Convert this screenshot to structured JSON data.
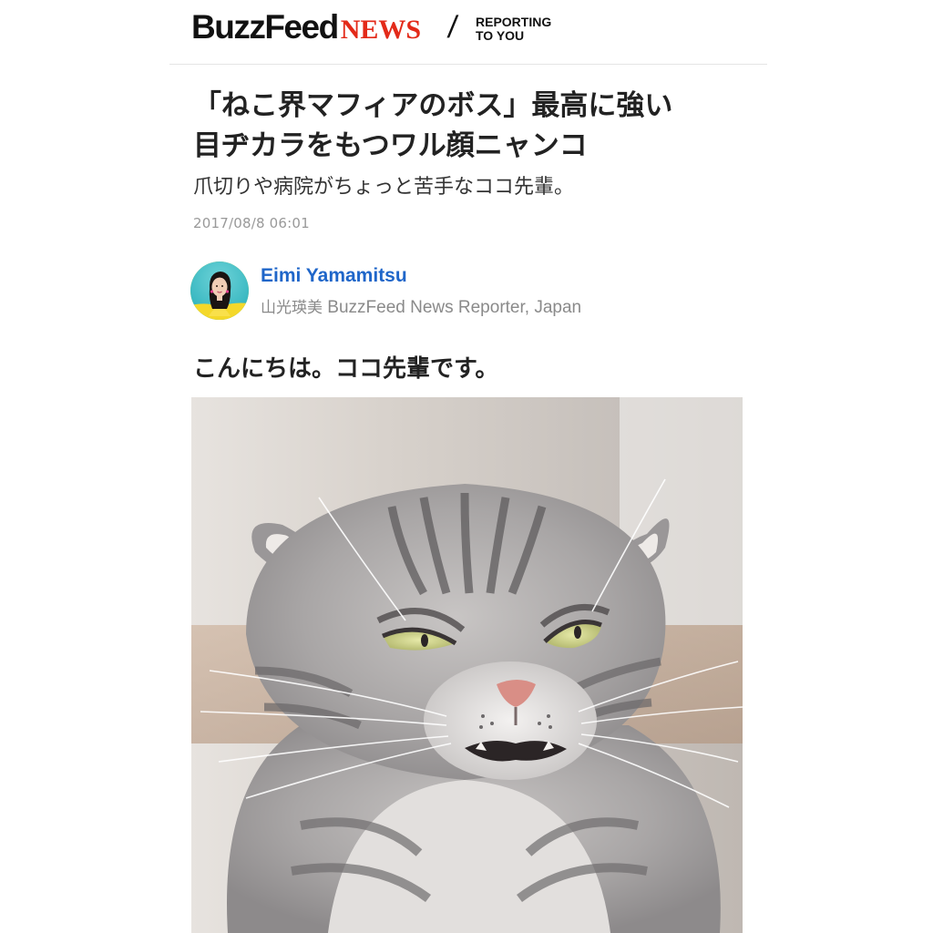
{
  "header": {
    "logo_buzzfeed": "BuzzFeed",
    "logo_news": "NEWS",
    "divider": "/",
    "tagline_line1": "REPORTING",
    "tagline_line2": "TO YOU"
  },
  "article": {
    "headline_line1": "「ねこ界マフィアのボス」最高に強い",
    "headline_line2": "目ヂカラをもつワル顔ニャンコ",
    "subtitle": "爪切りや病院がちょっと苦手なココ先輩。",
    "timestamp": "2017/08/8 06:01",
    "lead": "こんにちは。ココ先輩です。"
  },
  "author": {
    "name": "Eimi Yamamitsu",
    "name_jp": "山光瑛美",
    "role": "BuzzFeed News Reporter, Japan"
  },
  "colors": {
    "brand_red": "#e32a19",
    "link_blue": "#1f66c9",
    "meta_gray": "#999999"
  }
}
